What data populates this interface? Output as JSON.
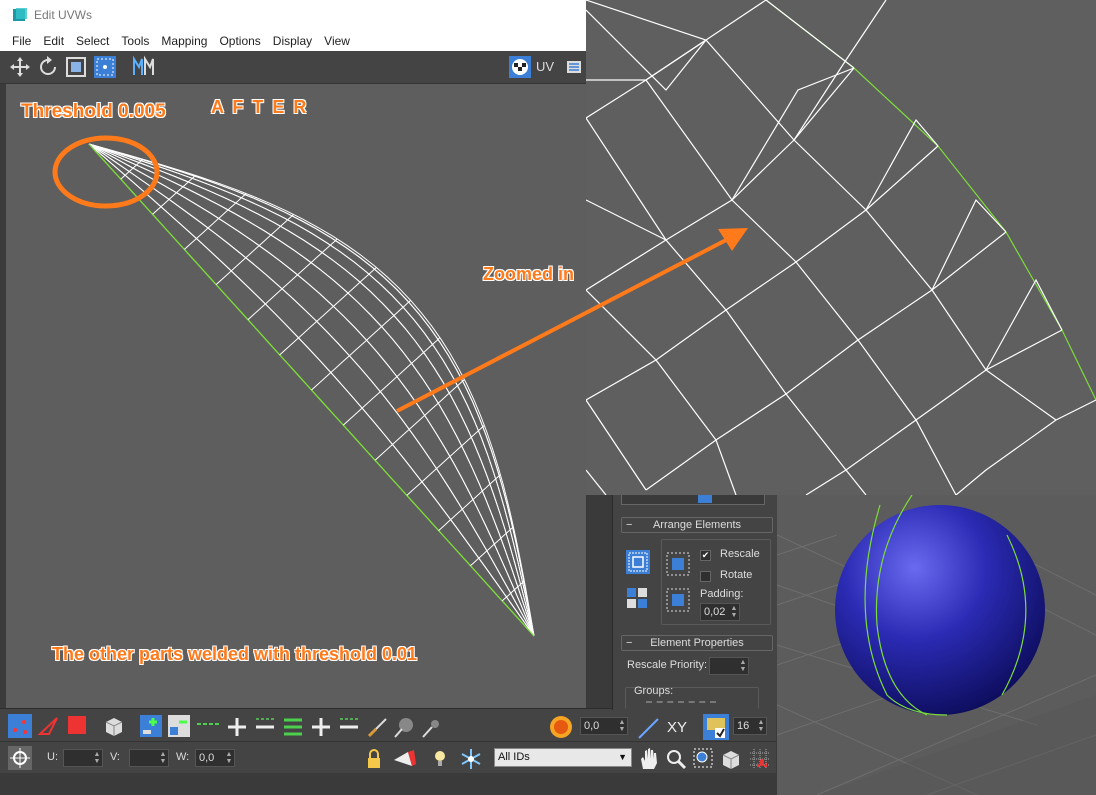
{
  "window": {
    "title": "Edit UVWs"
  },
  "menu": [
    "File",
    "Edit",
    "Select",
    "Tools",
    "Mapping",
    "Options",
    "Display",
    "View"
  ],
  "toolbar_top": {
    "uv_label": "UV"
  },
  "annotations": {
    "threshold": "Threshold 0.005",
    "after": "A F T E R",
    "zoomed": "Zoomed in",
    "other_parts": "The other parts welded with threshold 0.01"
  },
  "bottom": {
    "u_label": "U:",
    "v_label": "V:",
    "w_label": "W:",
    "w_value": "0,0",
    "soft_value": "0,0",
    "xy_label": "XY",
    "grid_value": "16",
    "ids_select": "All IDs"
  },
  "arrange": {
    "header": "Arrange Elements",
    "rescale_label": "Rescale",
    "rescale_checked": true,
    "rotate_label": "Rotate",
    "rotate_checked": false,
    "padding_label": "Padding:",
    "padding_value": "0,02"
  },
  "element_props": {
    "header": "Element Properties",
    "rescale_priority_label": "Rescale Priority:",
    "groups_label": "Groups:"
  },
  "colors": {
    "annotation": "#ff7a1a",
    "seam_green": "#7cdc3a",
    "sphere_blue": "#2b2bb5"
  }
}
